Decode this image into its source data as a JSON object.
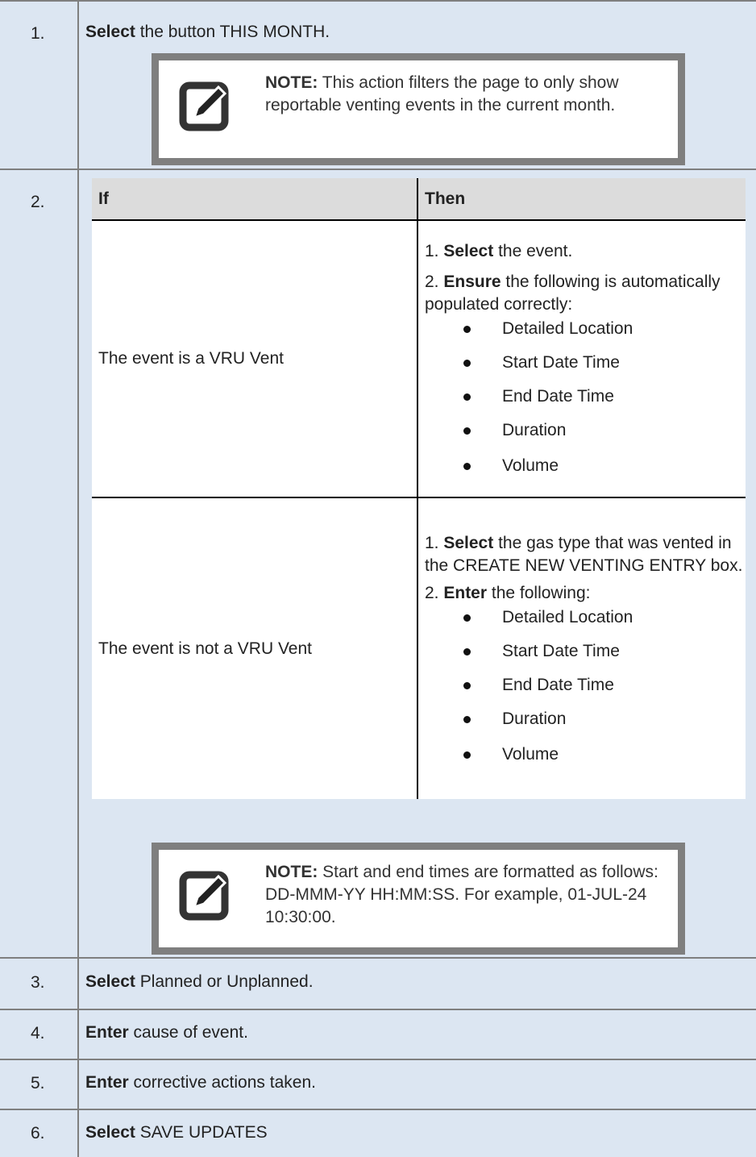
{
  "steps": [
    {
      "num": "1.",
      "bold": "Select",
      "rest": " the button THIS MONTH."
    },
    {
      "num": "2."
    },
    {
      "num": "3.",
      "bold": "Select",
      "rest": " Planned or Unplanned."
    },
    {
      "num": "4.",
      "bold": "Enter",
      "rest": " cause of event."
    },
    {
      "num": "5.",
      "bold": "Enter",
      "rest": " corrective actions taken."
    },
    {
      "num": "6.",
      "bold": "Select",
      "rest": " SAVE UPDATES"
    }
  ],
  "note1": {
    "label": "NOTE:",
    "text": " This action filters the page to only show reportable venting events in the current month."
  },
  "note2": {
    "label": "NOTE:",
    "text": " Start and end times are formatted as follows: DD-MMM-YY HH:MM:SS. For example, 01-JUL-24 10:30:00."
  },
  "table": {
    "headers": [
      "If",
      "Then"
    ],
    "rows": [
      {
        "if": "The event is a VRU Vent",
        "s1_num": "1. ",
        "s1_bold": "Select",
        "s1_rest": " the event.",
        "s2_num": "2. ",
        "s2_bold": "Ensure",
        "s2_rest": " the following is automatically populated correctly:",
        "bullets": [
          "Detailed Location",
          "Start Date Time",
          "End Date Time",
          "Duration",
          "Volume"
        ]
      },
      {
        "if": "The event is not a VRU Vent",
        "s1_num": "1. ",
        "s1_bold": "Select",
        "s1_rest": " the gas type that was vented in the CREATE NEW VENTING ENTRY box.",
        "s2_num": "2. ",
        "s2_bold": "Enter",
        "s2_rest": " the following:",
        "bullets": [
          "Detailed Location",
          "Start Date Time",
          "End Date Time",
          "Duration",
          "Volume"
        ]
      }
    ]
  },
  "icons": {
    "note": "pencil-note-icon"
  }
}
